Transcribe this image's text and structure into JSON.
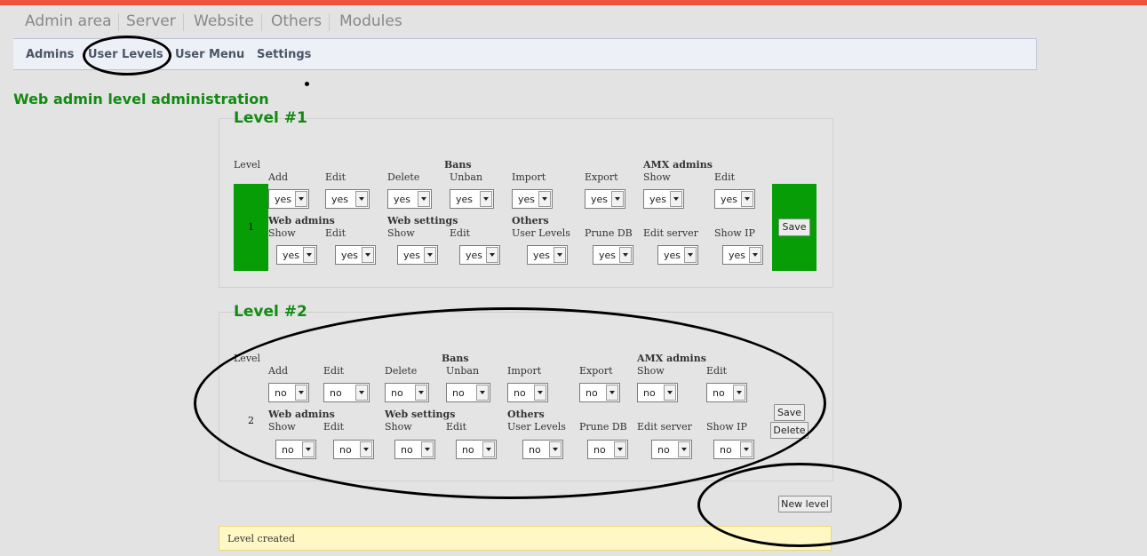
{
  "main_nav": [
    "Admin area",
    "Server",
    "Website",
    "Others",
    "Modules"
  ],
  "sub_nav": [
    "Admins",
    "User Levels",
    "User Menu",
    "Settings"
  ],
  "page_title": "Web admin level administration",
  "labels": {
    "level": "Level",
    "groups": {
      "bans": "Bans",
      "amx_admins": "AMX admins",
      "web_admins": "Web admins",
      "web_settings": "Web settings",
      "others": "Others"
    },
    "row1": [
      "Add",
      "Edit",
      "Delete",
      "Unban",
      "Import",
      "Export",
      "Show",
      "Edit"
    ],
    "row2": [
      "Show",
      "Edit",
      "Show",
      "Edit",
      "User Levels",
      "Prune DB",
      "Edit server",
      "Show IP"
    ]
  },
  "levels": [
    {
      "title": "Level #1",
      "number": "1",
      "row1_values": [
        "yes",
        "yes",
        "yes",
        "yes",
        "yes",
        "yes",
        "yes",
        "yes"
      ],
      "row2_values": [
        "yes",
        "yes",
        "yes",
        "yes",
        "yes",
        "yes",
        "yes",
        "yes"
      ],
      "buttons": [
        "Save"
      ]
    },
    {
      "title": "Level #2",
      "number": "2",
      "row1_values": [
        "no",
        "no",
        "no",
        "no",
        "no",
        "no",
        "no",
        "no"
      ],
      "row2_values": [
        "no",
        "no",
        "no",
        "no",
        "no",
        "no",
        "no",
        "no"
      ],
      "buttons": [
        "Save",
        "Delete"
      ]
    }
  ],
  "new_level_button": "New level",
  "status_message": "Level created",
  "colors": {
    "accent_bar": "#f0533b",
    "green": "#079d07",
    "title_green": "#138a13",
    "notice_bg": "#fff8c5"
  }
}
